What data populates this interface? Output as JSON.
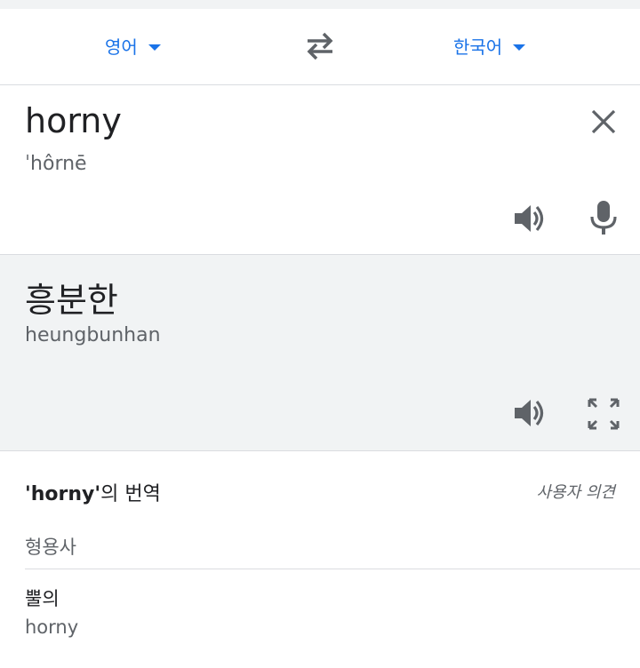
{
  "language_bar": {
    "source_lang": "영어",
    "target_lang": "한국어"
  },
  "source": {
    "text": "horny",
    "transliteration": "ˈhôrnē"
  },
  "result": {
    "text": "흥분한",
    "transliteration": "heungbunhan"
  },
  "dictionary": {
    "title_term": "'horny'",
    "title_suffix": "의 번역",
    "feedback_label": "사용자 의견",
    "part_of_speech": "형용사",
    "entries": [
      {
        "word": "뿔의",
        "back_translation": "horny"
      }
    ]
  },
  "icons": {
    "dropdown": "caret-down-icon",
    "swap": "swap-arrows-icon",
    "clear": "close-icon",
    "speaker": "speaker-icon",
    "mic": "microphone-icon",
    "expand": "fullscreen-icon"
  },
  "colors": {
    "accent": "#1a73e8",
    "icon": "#5f6368",
    "result_bg": "#f1f3f4",
    "divider": "#dadce0"
  }
}
